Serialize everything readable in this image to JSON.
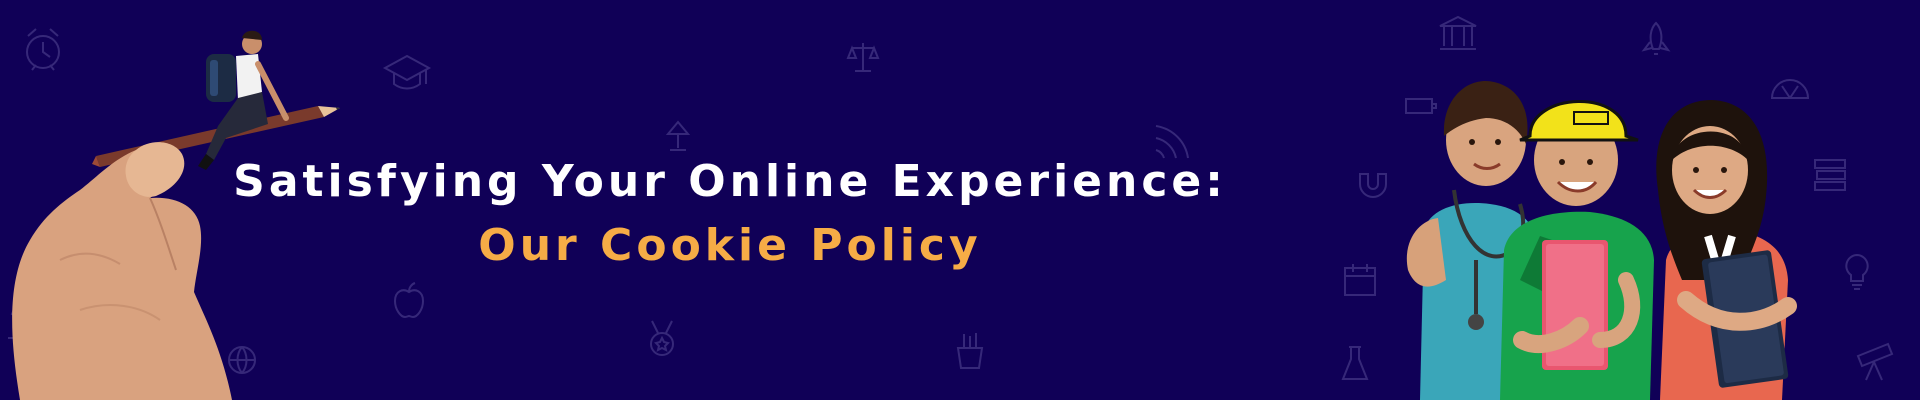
{
  "banner": {
    "title_line1": "Satisfying Your Online Experience:",
    "title_line2": "Our Cookie Policy",
    "colors": {
      "background": "#100057",
      "title": "#ffffff",
      "highlight": "#f6ac46"
    }
  },
  "illustrations": {
    "left": "hand-holding-pencil-with-student-riding",
    "right": "three-children-with-books-and-hard-hat"
  },
  "background_icons": [
    "alarm-clock-icon",
    "graduation-cap-icon",
    "scales-icon",
    "lamp-icon",
    "apple-icon",
    "medal-icon",
    "pencil-cup-icon",
    "wifi-icon",
    "building-icon",
    "rocket-icon",
    "protractor-icon",
    "books-icon",
    "lightbulb-icon",
    "flask-icon",
    "telescope-icon",
    "microscope-icon",
    "globe-icon",
    "calendar-icon",
    "battery-icon",
    "magnet-icon"
  ]
}
